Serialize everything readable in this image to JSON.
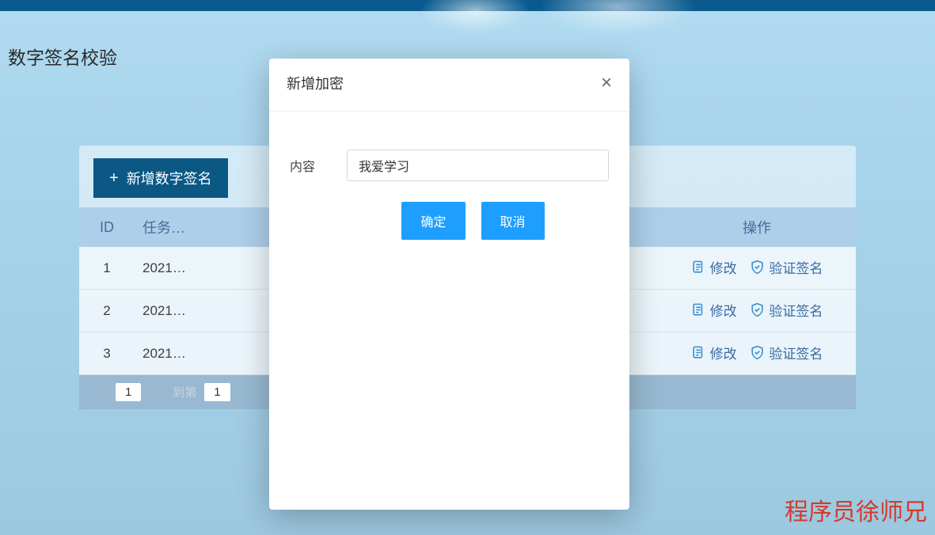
{
  "page": {
    "title": "数字签名校验"
  },
  "toolbar": {
    "add_button": "新增数字签名"
  },
  "table": {
    "headers": {
      "id": "ID",
      "task": "任务…",
      "action": "操作"
    },
    "rows": [
      {
        "id": "1",
        "task": "2021…",
        "edit": "修改",
        "verify": "验证签名"
      },
      {
        "id": "2",
        "task": "2021…",
        "edit": "修改",
        "verify": "验证签名"
      },
      {
        "id": "3",
        "task": "2021…",
        "edit": "修改",
        "verify": "验证签名"
      }
    ]
  },
  "pagination": {
    "current": "1",
    "goto_label": "到第",
    "goto": "1"
  },
  "modal": {
    "title": "新增加密",
    "field_label": "内容",
    "field_value": "我爱学习",
    "confirm": "确定",
    "cancel": "取消"
  },
  "watermark": "程序员徐师兄"
}
